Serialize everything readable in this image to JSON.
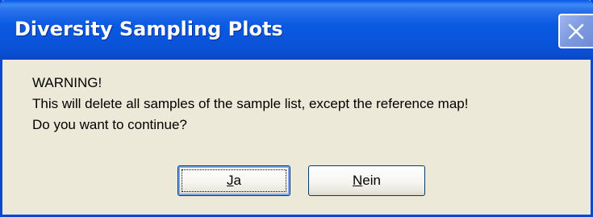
{
  "window": {
    "title": "Diversity Sampling Plots"
  },
  "message": {
    "lines": [
      "WARNING!",
      "This will delete all samples of the sample list, except the reference map!",
      "Do you want to continue?"
    ]
  },
  "buttons": {
    "yes": {
      "mnemonic": "J",
      "rest": "a",
      "label": "Ja"
    },
    "no": {
      "mnemonic": "N",
      "rest": "ein",
      "label": "Nein"
    }
  },
  "titlebar": {
    "close_icon": "close-icon",
    "color": "#0a54da"
  },
  "colors": {
    "dialog_background": "#ece9d8",
    "title_text": "#ffffff"
  }
}
